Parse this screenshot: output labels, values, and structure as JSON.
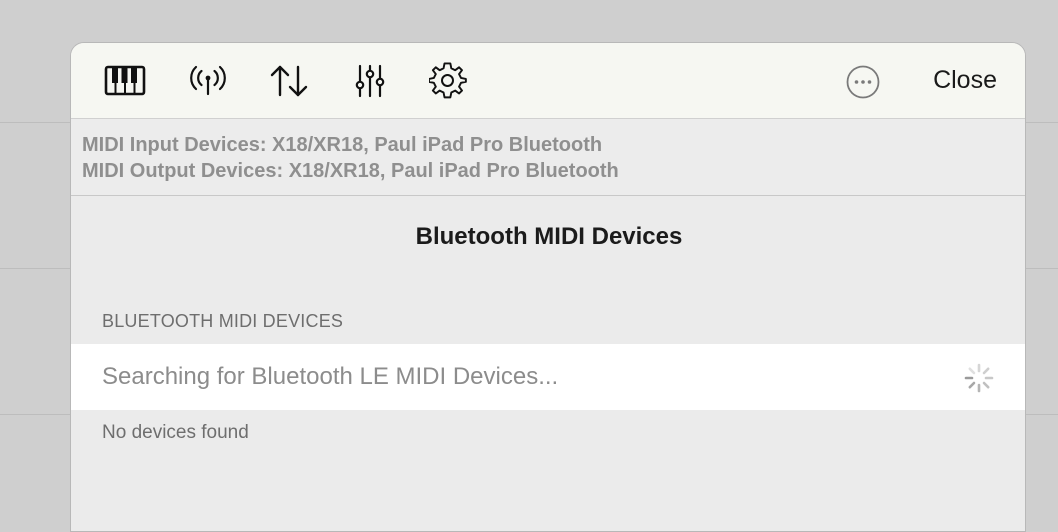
{
  "toolbar": {
    "icons": [
      "piano-keyboard-icon",
      "broadcast-icon",
      "arrows-up-down-icon",
      "sliders-icon",
      "gear-icon"
    ],
    "more_icon": "ellipsis-circle-icon",
    "close_label": "Close"
  },
  "status": {
    "input_line": "MIDI Input Devices: X18/XR18, Paul iPad Pro Bluetooth",
    "output_line": "MIDI Output Devices: X18/XR18, Paul iPad Pro Bluetooth"
  },
  "page_title": "Bluetooth MIDI Devices",
  "section": {
    "header": "BLUETOOTH MIDI DEVICES",
    "searching_label": "Searching for Bluetooth LE MIDI Devices...",
    "footer": "No devices found"
  },
  "colors": {
    "toolbar_bg": "#f6f7f2",
    "panel_bg": "#ebebeb",
    "row_bg": "#ffffff",
    "muted_text": "#8f8f8f"
  }
}
